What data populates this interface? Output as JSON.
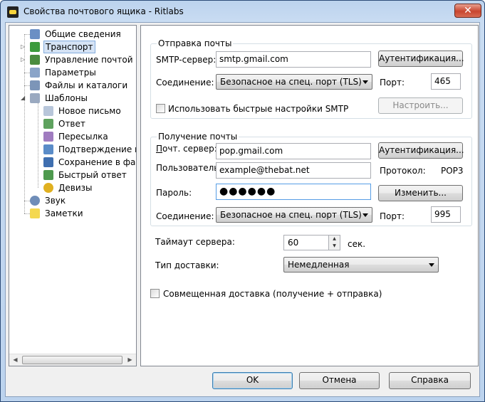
{
  "window": {
    "title": "Свойства почтового ящика - Ritlabs",
    "close": "✕"
  },
  "tree": {
    "items": [
      {
        "label": "Общие сведения"
      },
      {
        "label": "Транспорт"
      },
      {
        "label": "Управление почтой"
      },
      {
        "label": "Параметры"
      },
      {
        "label": "Файлы и каталоги"
      },
      {
        "label": "Шаблоны"
      },
      {
        "label": "Новое письмо"
      },
      {
        "label": "Ответ"
      },
      {
        "label": "Пересылка"
      },
      {
        "label": "Подтверждение прочтения"
      },
      {
        "label": "Сохранение в файл"
      },
      {
        "label": "Быстрый ответ"
      },
      {
        "label": "Девизы"
      },
      {
        "label": "Звук"
      },
      {
        "label": "Заметки"
      }
    ]
  },
  "smtp": {
    "group_title": "Отправка почты",
    "server_label": "SMTP-сервер:",
    "server_value": "smtp.gmail.com",
    "auth_button": "Аутентификация...",
    "connection_label": "Соединение:",
    "connection_value": "Безопасное на спец. порт (TLS)",
    "port_label": "Порт:",
    "port_value": "465",
    "quick_smtp_label": "Использовать быстрые настройки SMTP",
    "configure_button": "Настроить..."
  },
  "pop": {
    "group_title": "Получение почты",
    "server_label": "Почт. сервер:",
    "server_value": "pop.gmail.com",
    "auth_button": "Аутентификация...",
    "user_label": "Пользователь:",
    "user_value": "example@thebat.net",
    "protocol_label": "Протокол:",
    "protocol_value": "POP3",
    "password_label": "Пароль:",
    "password_value": "●●●●●●",
    "change_button": "Изменить...",
    "connection_label": "Соединение:",
    "connection_value": "Безопасное на спец. порт (TLS)",
    "port_label": "Порт:",
    "port_value": "995"
  },
  "misc": {
    "timeout_label": "Таймаут сервера:",
    "timeout_value": "60",
    "timeout_unit": "сек.",
    "delivery_label": "Тип доставки:",
    "delivery_value": "Немедленная",
    "combined_label": "Совмещенная доставка (получение + отправка)"
  },
  "buttons": {
    "ok": "OK",
    "cancel": "Отмена",
    "help": "Справка"
  }
}
